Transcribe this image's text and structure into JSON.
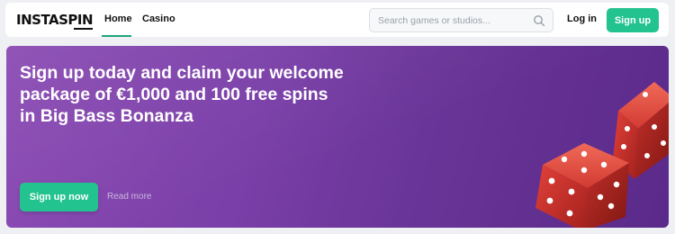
{
  "header": {
    "logo_text": "INSTASPIN",
    "nav": [
      {
        "label": "Home",
        "active": true
      },
      {
        "label": "Casino",
        "active": false
      }
    ],
    "search": {
      "placeholder": "Search games or studios...",
      "value": ""
    },
    "login_label": "Log in",
    "signup_label": "Sign up"
  },
  "hero": {
    "title": "Sign up today and claim your welcome package of €1,000 and 100 free spins in Big Bass Bonanza",
    "cta_label": "Sign up now",
    "read_more_label": "Read more",
    "image": "red-dice"
  },
  "colors": {
    "accent": "#22c38e",
    "hero_bg": "#7a3fa8",
    "page_bg": "#eef0f3"
  }
}
